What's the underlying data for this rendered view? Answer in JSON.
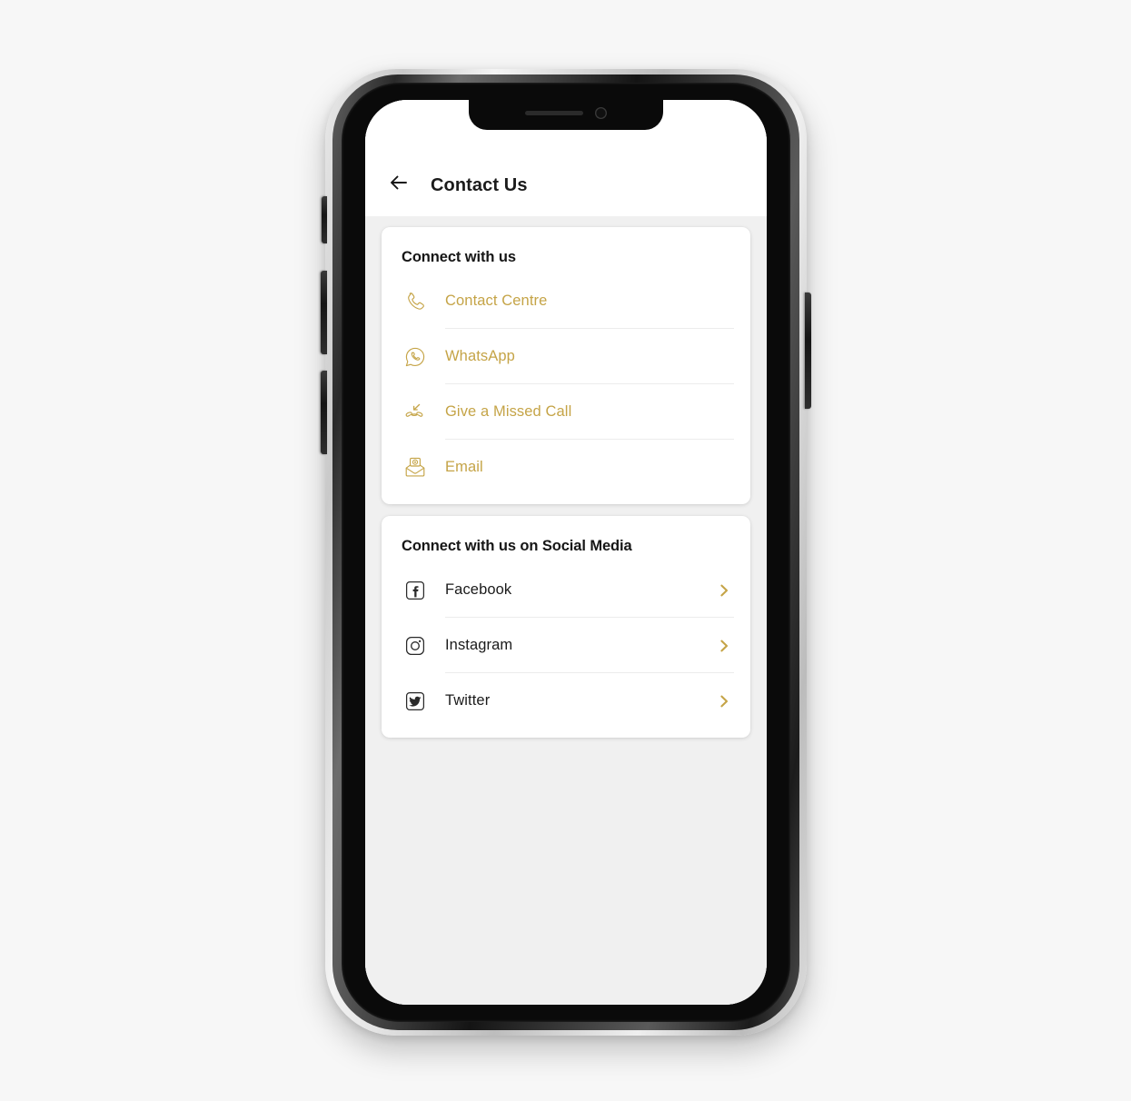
{
  "app": {
    "header": {
      "back_icon": "arrow-left-icon",
      "title": "Contact Us"
    },
    "sections": [
      {
        "id": "connect-with-us",
        "title": "Connect with us",
        "style": "gold",
        "items": [
          {
            "label": "Contact Centre",
            "icon": "phone-call-icon",
            "divider": true
          },
          {
            "label": "WhatsApp",
            "icon": "whatsapp-icon",
            "divider": true
          },
          {
            "label": "Give a Missed Call",
            "icon": "missed-call-icon",
            "divider": true
          },
          {
            "label": "Email",
            "icon": "email-at-icon",
            "divider": false
          }
        ]
      },
      {
        "id": "connect-social-media",
        "title": "Connect with us on Social Media",
        "style": "dark",
        "items": [
          {
            "label": "Facebook",
            "icon": "facebook-icon",
            "chevron": "chevron-right-icon",
            "divider": true
          },
          {
            "label": "Instagram",
            "icon": "instagram-icon",
            "chevron": "chevron-right-icon",
            "divider": true
          },
          {
            "label": "Twitter",
            "icon": "twitter-icon",
            "chevron": "chevron-right-icon",
            "divider": false
          }
        ]
      }
    ]
  },
  "device": {
    "type": "smartphone-mockup",
    "notch_speaker": "speaker-grille",
    "notch_camera": "front-camera",
    "buttons": [
      "mute-switch",
      "volume-up-button",
      "volume-down-button",
      "power-button"
    ]
  },
  "colors": {
    "accent_gold": "#c5a447",
    "text_dark": "#1b1b1b",
    "card_background": "#ffffff",
    "app_background": "#f0f0f0",
    "page_background": "#f7f7f7",
    "divider": "#ececec"
  }
}
